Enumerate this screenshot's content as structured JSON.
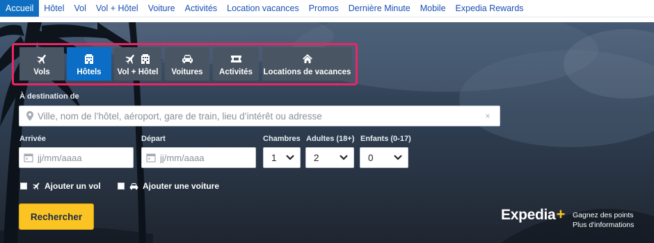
{
  "topnav": {
    "items": [
      {
        "label": "Accueil",
        "active": true
      },
      {
        "label": "Hôtel"
      },
      {
        "label": "Vol"
      },
      {
        "label": "Vol + Hôtel"
      },
      {
        "label": "Voiture"
      },
      {
        "label": "Activités"
      },
      {
        "label": "Location vacances"
      },
      {
        "label": "Promos"
      },
      {
        "label": "Dernière Minute"
      },
      {
        "label": "Mobile"
      },
      {
        "label": "Expedia Rewards"
      }
    ]
  },
  "tabs": [
    {
      "label": "Vols",
      "icon": "plane-icon"
    },
    {
      "label": "Hôtels",
      "icon": "hotel-icon",
      "active": true
    },
    {
      "label": "Vol + Hôtel",
      "icon": "plane-hotel-icon"
    },
    {
      "label": "Voitures",
      "icon": "car-icon"
    },
    {
      "label": "Activités",
      "icon": "ticket-icon"
    },
    {
      "label": "Locations de vacances",
      "icon": "house-icon"
    }
  ],
  "form": {
    "destination_label": "À destination de",
    "destination_placeholder": "Ville, nom de l’hôtel, aéroport, gare de train, lieu d’intérêt ou adresse",
    "clear_symbol": "×",
    "checkin_label": "Arrivée",
    "checkin_placeholder": "jj/mm/aaaa",
    "checkout_label": "Départ",
    "checkout_placeholder": "jj/mm/aaaa",
    "rooms_label": "Chambres",
    "rooms_value": "1",
    "adults_label": "Adultes (18+)",
    "adults_value": "2",
    "children_label": "Enfants (0-17)",
    "children_value": "0",
    "add_flight_label": "Ajouter un vol",
    "add_car_label": "Ajouter une voiture",
    "search_label": "Rechercher"
  },
  "brand": {
    "name": "Expedia",
    "plus": "+",
    "rewards_line1": "Gagnez des points",
    "rewards_line2": "Plus d'informations"
  },
  "colors": {
    "accent": "#0b6dc6",
    "highlight_outline": "#ee2463",
    "search_button": "#fbc422",
    "link": "#1a4fb3"
  }
}
